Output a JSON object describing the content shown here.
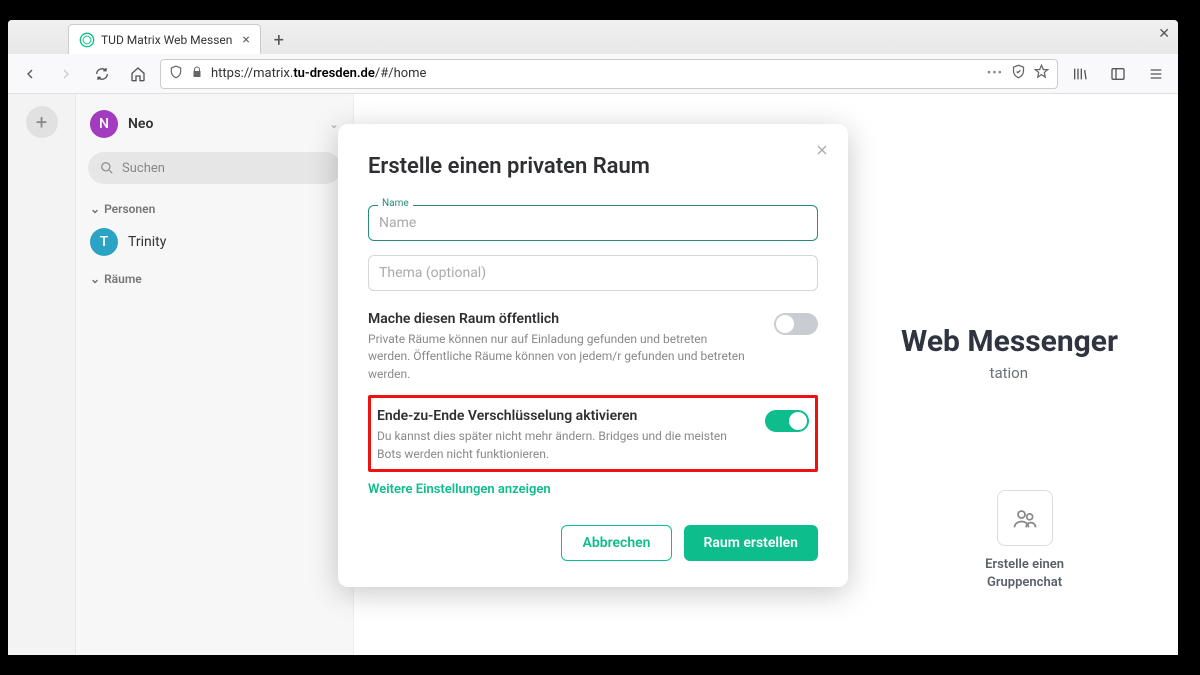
{
  "browser": {
    "tab_title": "TUD Matrix Web Messen",
    "url_prefix": "https://matrix.",
    "url_bold": "tu-dresden.de",
    "url_suffix": "/#/home"
  },
  "sidebar": {
    "user_initial": "N",
    "user_name": "Neo",
    "search_placeholder": "Suchen",
    "section_people": "Personen",
    "contacts": [
      {
        "initial": "T",
        "name": "Trinity"
      }
    ],
    "section_rooms": "Räume"
  },
  "background": {
    "title_suffix": "Web Messenger",
    "subtitle_suffix": "tation",
    "card_line1": "Erstelle einen",
    "card_line2": "Gruppenchat"
  },
  "modal": {
    "title": "Erstelle einen privaten Raum",
    "name_label": "Name",
    "name_placeholder": "Name",
    "topic_placeholder": "Thema (optional)",
    "public_title": "Mache diesen Raum öffentlich",
    "public_desc": "Private Räume können nur auf Einladung gefunden und betreten werden. Öffentliche Räume können von jedem/r gefunden und betreten werden.",
    "e2e_title": "Ende-zu-Ende Verschlüsselung aktivieren",
    "e2e_desc": "Du kannst dies später nicht mehr ändern. Bridges und die meisten Bots werden nicht funktionieren.",
    "more_settings": "Weitere Einstellungen anzeigen",
    "cancel": "Abbrechen",
    "create": "Raum erstellen"
  }
}
